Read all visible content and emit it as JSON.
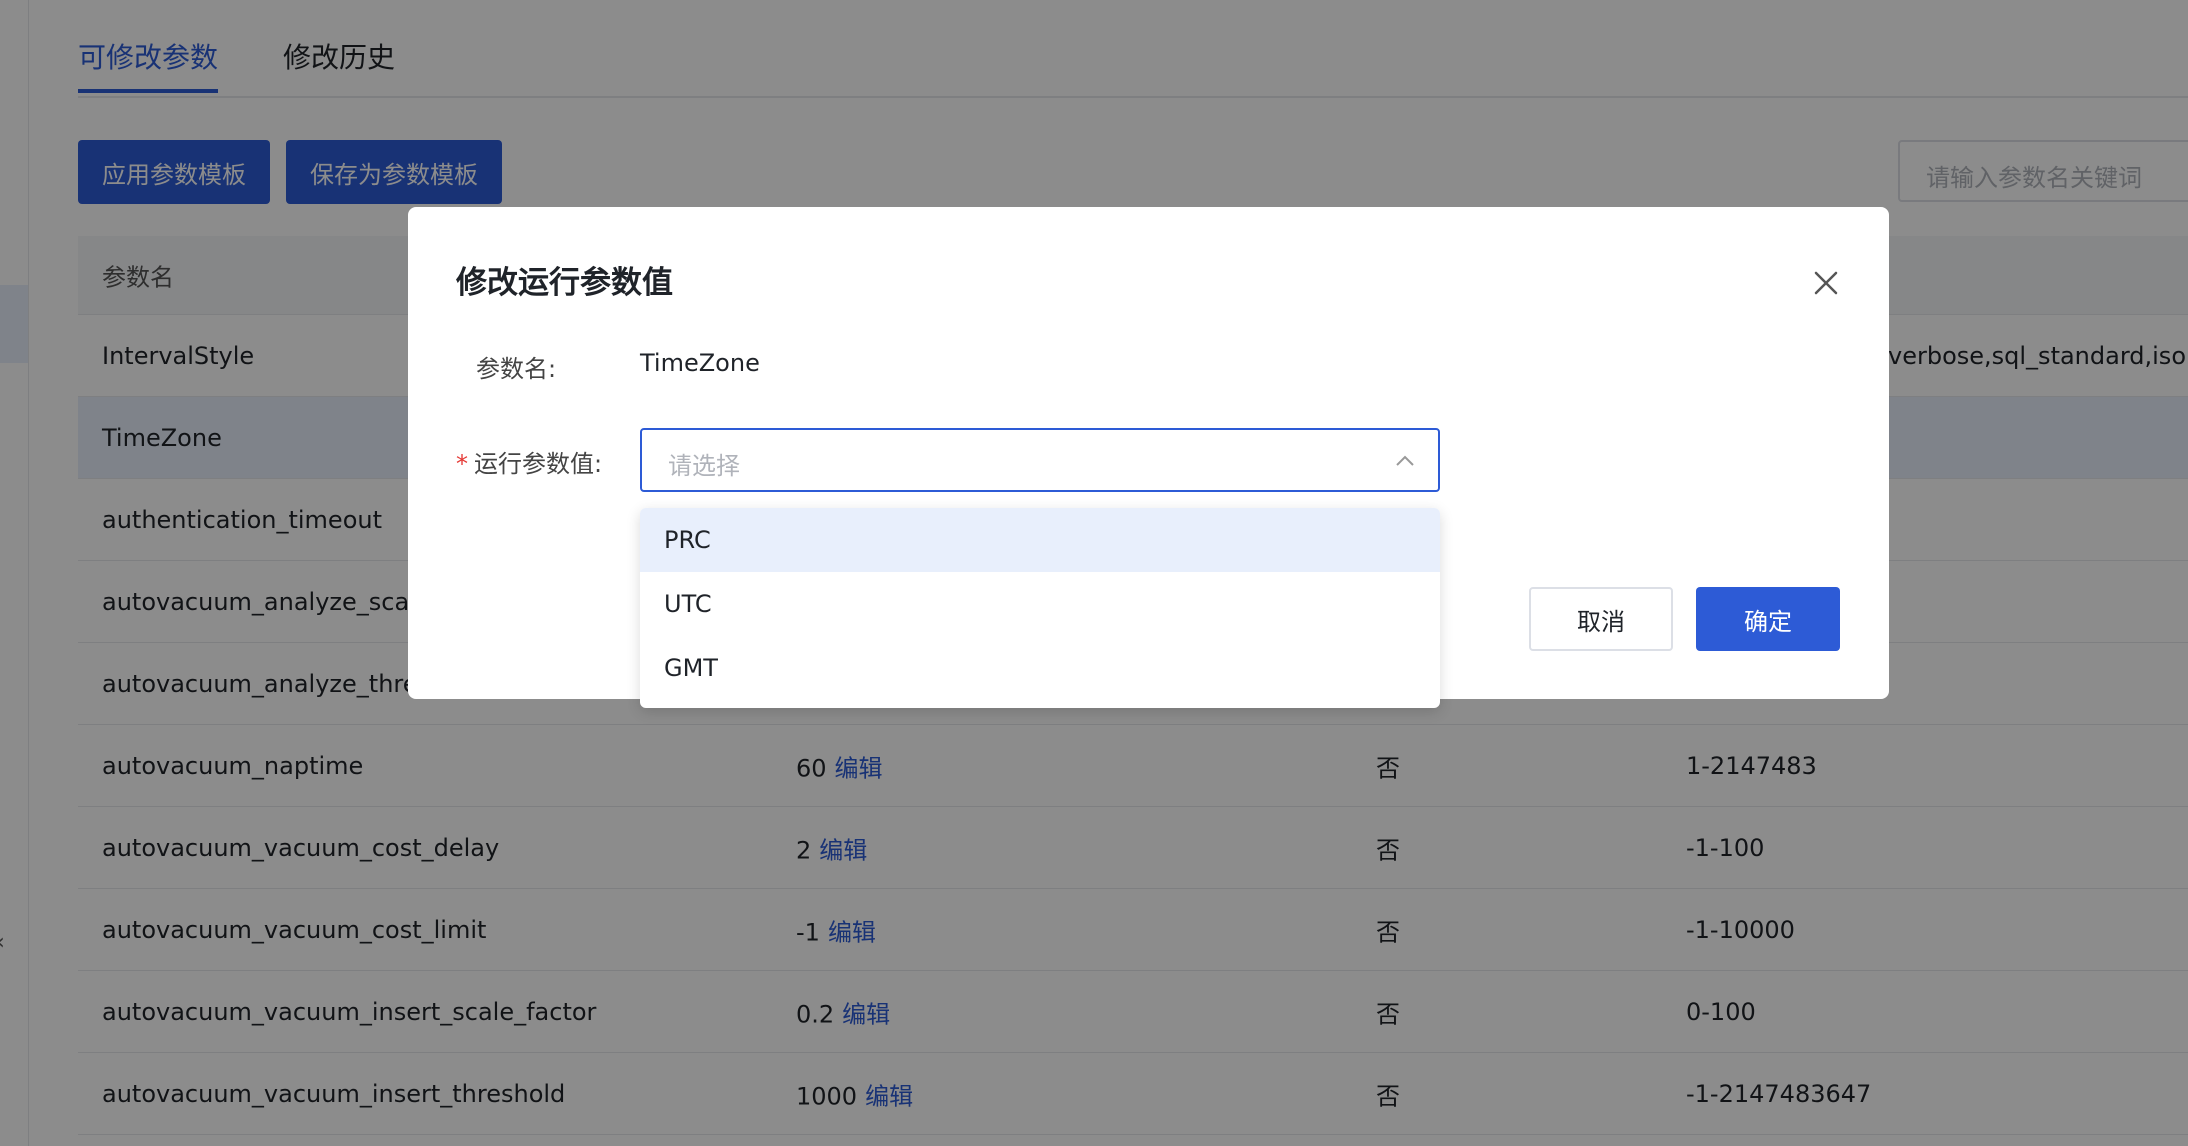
{
  "tabs": [
    {
      "label": "可修改参数"
    },
    {
      "label": "修改历史"
    }
  ],
  "toolbar": {
    "apply_template_label": "应用参数模板",
    "save_template_label": "保存为参数模板",
    "search_placeholder": "请输入参数名关键词"
  },
  "table": {
    "header": {
      "name": "参数名"
    },
    "rows": [
      {
        "name": "IntervalStyle",
        "value": "",
        "edit": "",
        "restart": "",
        "range": "_verbose,sql_standard,iso"
      },
      {
        "name": "TimeZone",
        "value": "",
        "edit": "",
        "restart": "",
        "range": ""
      },
      {
        "name": "authentication_timeout",
        "value": "",
        "edit": "",
        "restart": "",
        "range": ""
      },
      {
        "name": "autovacuum_analyze_scale",
        "value": "",
        "edit": "",
        "restart": "",
        "range": ""
      },
      {
        "name": "autovacuum_analyze_thres",
        "value": "",
        "edit": "",
        "restart": "",
        "range": ""
      },
      {
        "name": "autovacuum_naptime",
        "value": "60",
        "edit": "编辑",
        "restart": "否",
        "range": "1-2147483"
      },
      {
        "name": "autovacuum_vacuum_cost_delay",
        "value": "2",
        "edit": "编辑",
        "restart": "否",
        "range": "-1-100"
      },
      {
        "name": "autovacuum_vacuum_cost_limit",
        "value": "-1",
        "edit": "编辑",
        "restart": "否",
        "range": "-1-10000"
      },
      {
        "name": "autovacuum_vacuum_insert_scale_factor",
        "value": "0.2",
        "edit": "编辑",
        "restart": "否",
        "range": "0-100"
      },
      {
        "name": "autovacuum_vacuum_insert_threshold",
        "value": "1000",
        "edit": "编辑",
        "restart": "否",
        "range": "-1-2147483647"
      }
    ]
  },
  "modal": {
    "title": "修改运行参数值",
    "param_name_label": "参数名:",
    "param_name_value": "TimeZone",
    "required_mark": "*",
    "run_value_label": "运行参数值:",
    "select_placeholder": "请选择",
    "options": [
      "PRC",
      "UTC",
      "GMT"
    ],
    "cancel_label": "取消",
    "ok_label": "确定"
  },
  "colors": {
    "primary": "#2d5bd6",
    "selected_row": "#e8effc",
    "required": "#e53935"
  },
  "icons": {
    "close": "close-icon",
    "select_arrow": "chevron-up-icon"
  }
}
